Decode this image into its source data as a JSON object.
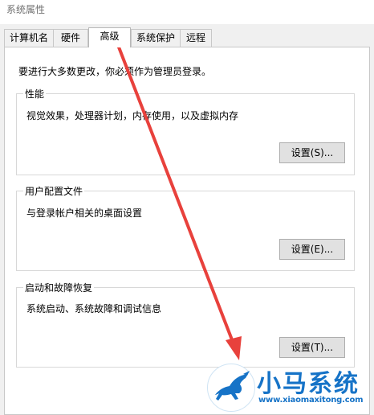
{
  "window": {
    "title": "系统属性"
  },
  "tabs": [
    {
      "label": "计算机名",
      "active": false
    },
    {
      "label": "硬件",
      "active": false
    },
    {
      "label": "高级",
      "active": true
    },
    {
      "label": "系统保护",
      "active": false
    },
    {
      "label": "远程",
      "active": false
    }
  ],
  "advanced": {
    "admin_note": "要进行大多数更改，你必须作为管理员登录。",
    "performance": {
      "title": "性能",
      "description": "视觉效果，处理器计划，内存使用，以及虚拟内存",
      "button": "设置(S)..."
    },
    "user_profiles": {
      "title": "用户配置文件",
      "description": "与登录帐户相关的桌面设置",
      "button": "设置(E)..."
    },
    "startup_recovery": {
      "title": "启动和故障恢复",
      "description": "系统启动、系统故障和调试信息",
      "button": "设置(T)..."
    }
  },
  "watermark": {
    "name": "小马系统",
    "url": "www.xiaomaxitong.com",
    "logo_icon": "horse-logo-icon"
  },
  "annotation": {
    "arrow_color": "#e8413c"
  },
  "colors": {
    "watermark_blue": "#1673c7"
  }
}
